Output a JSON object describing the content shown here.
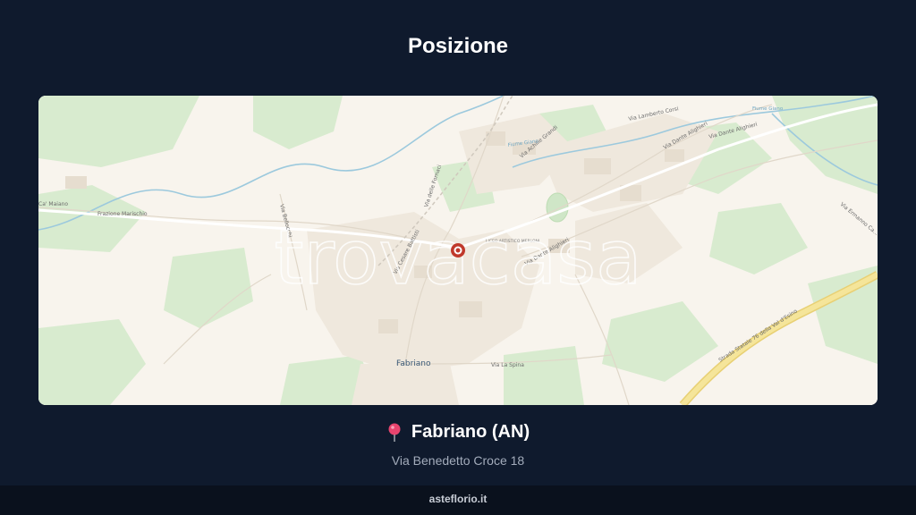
{
  "page": {
    "title": "Posizione"
  },
  "map": {
    "watermark": "trovacasa",
    "marker_icon": "location-target-icon",
    "town_label": "Fabriano",
    "poi_label": "LICEO ARTISTICO MERLONI",
    "streets": [
      "Ca' Maiano",
      "Frazione Marischio",
      "Via Cesare Battisti",
      "Via delle Fornaci",
      "Via Bellocchi",
      "Via Dante Alighieri",
      "Via Dante Alighieri",
      "Via Dante Alighieri",
      "Via La Spina",
      "Via Achille Grandi",
      "Via Lamberto Corsi",
      "Via Ermanno Ca...",
      "Strada Statale 76 della Val d'Esino",
      "Fiume Giano",
      "Fiume Giano"
    ]
  },
  "location": {
    "pin_icon": "map-pin-icon",
    "city": "Fabriano (AN)",
    "address": "Via Benedetto Croce 18"
  },
  "footer": {
    "site": "asteflorio.it"
  },
  "colors": {
    "background": "#0f1a2d",
    "footer_background": "#0a111d",
    "map_land": "#f8f4ed",
    "map_green": "#d6ebcf",
    "highway": "#f2e08a",
    "marker": "#c0392b"
  }
}
